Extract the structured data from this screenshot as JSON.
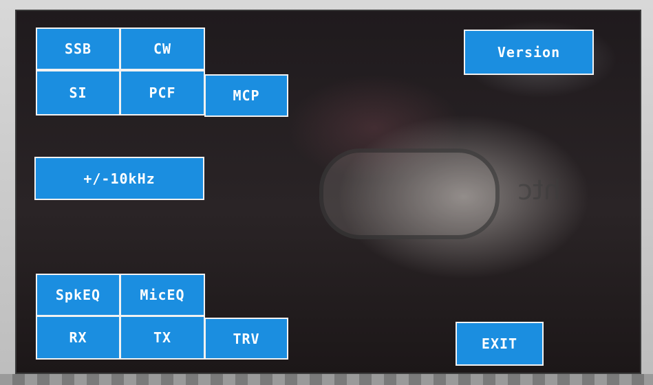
{
  "buttons": {
    "ssb": "SSB",
    "cw": "CW",
    "si": "SI",
    "pcf": "PCF",
    "mcp": "MCP",
    "version": "Version",
    "step": "+/-10kHz",
    "spkeq": "SpkEQ",
    "miceq": "MicEQ",
    "rx": "RX",
    "tx": "TX",
    "trv": "TRV",
    "exit": "EXIT"
  },
  "reflection_text": "htc",
  "colors": {
    "button_bg": "#1b8ee0",
    "button_text": "#ffffff",
    "screen_bg": "#221c1e"
  }
}
